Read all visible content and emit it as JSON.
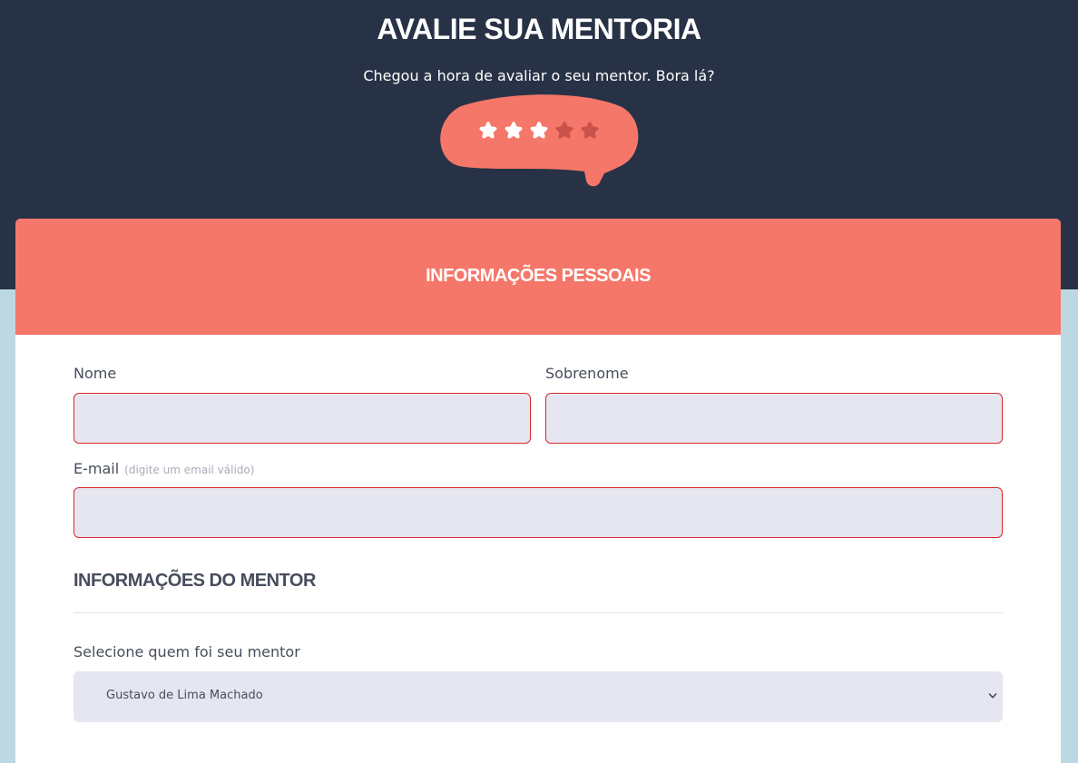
{
  "header": {
    "title": "AVALIE SUA MENTORIA",
    "subtitle": "Chegou a hora de avaliar o seu mentor. Bora lá?"
  },
  "rating": {
    "value": 3,
    "max": 5,
    "bubble_color": "#f5776a",
    "star_active_color": "#ffffff",
    "star_inactive_color": "#c9534b"
  },
  "form": {
    "section_personal_title": "INFORMAÇÕES PESSOAIS",
    "first_name_label": "Nome",
    "first_name_value": "",
    "last_name_label": "Sobrenome",
    "last_name_value": "",
    "email_label": "E-mail",
    "email_hint": "(digite um email válido)",
    "email_value": "",
    "section_mentor_title": "INFORMAÇÕES DO MENTOR",
    "mentor_select_label": "Selecione quem foi seu mentor",
    "mentor_selected": "Gustavo de Lima Machado"
  },
  "colors": {
    "header_bg": "#283246",
    "page_bg": "#bdd7e3",
    "accent": "#f5776a",
    "input_bg": "#e6e6f0",
    "input_border_invalid": "#d92a2a"
  }
}
